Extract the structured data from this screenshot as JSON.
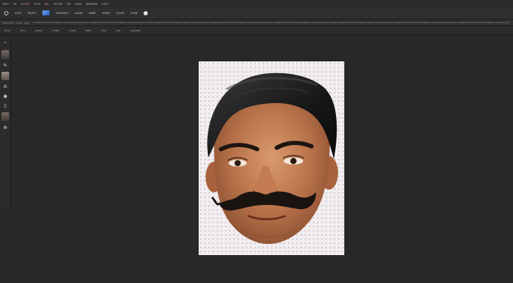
{
  "app": {
    "menu_items": [
      {
        "label": "ᴇᴅɪᴛ",
        "color": "#b9b9b9"
      },
      {
        "label": "ɪᴍ",
        "color": "#b9b9b9"
      },
      {
        "label": "ʟᴀʏᴇʀ",
        "color": "#e38ad6"
      },
      {
        "label": "ᴛʏᴘᴇ",
        "color": "#b9b9b9"
      },
      {
        "label": "ꜱᴇʟ",
        "color": "#e38ad6"
      },
      {
        "label": "ꜰɪʟᴛᴇʀ",
        "color": "#b9b9b9"
      },
      {
        "label": "3ᴅ",
        "color": "#b9b9b9"
      },
      {
        "label": "ᴠɪᴇᴡ",
        "color": "#b9b9b9"
      },
      {
        "label": "ᴡɪɴᴅᴏᴡ",
        "color": "#b9b9b9"
      },
      {
        "label": "ʜᴇʟᴘ",
        "color": "#b9b9b9"
      }
    ],
    "options": [
      "ᴀᴜᴛᴏ",
      "ꜱᴇʟᴇᴄᴛ",
      "ᴄᴏɴᴛʀᴏʟꜱ",
      "ᴀʟɪɢɴ",
      "ᴍᴏᴅᴇ",
      "ꜰʀᴏɴᴛ",
      "ᴄʟᴇᴀʀ",
      "ꜱʜᴏᴡ"
    ],
    "tabs": [
      "ᴜɴᴛɪᴛʟᴇᴅ",
      "ʟᴀʏᴇʀ",
      "ʀɢʙ"
    ],
    "toolbar2": [
      "ᴀᴜᴛᴏ",
      "ᴛᴏᴏʟ",
      "ɢʀᴏᴜᴘ",
      "ᴛʀᴀɴꜱ",
      "ᴀʟɪɢɴ",
      "ᴍᴏᴅᴇ",
      "ᴅɪꜱᴛ",
      "ꜱɪᴢᴇ",
      "ᴀʀʀᴀɴɢᴇ"
    ],
    "tools": [
      "move-tool",
      "photo-thumbnail",
      "brush-tool",
      "photo-thumbnail",
      "type-tool",
      "eye-tool",
      "crop-tool",
      "photo-thumbnail",
      "zoom-tool"
    ]
  },
  "document": {
    "subject": "illustrated portrait of a man with slicked-back black hair and a curled mustache",
    "background": "#f3eef0"
  }
}
